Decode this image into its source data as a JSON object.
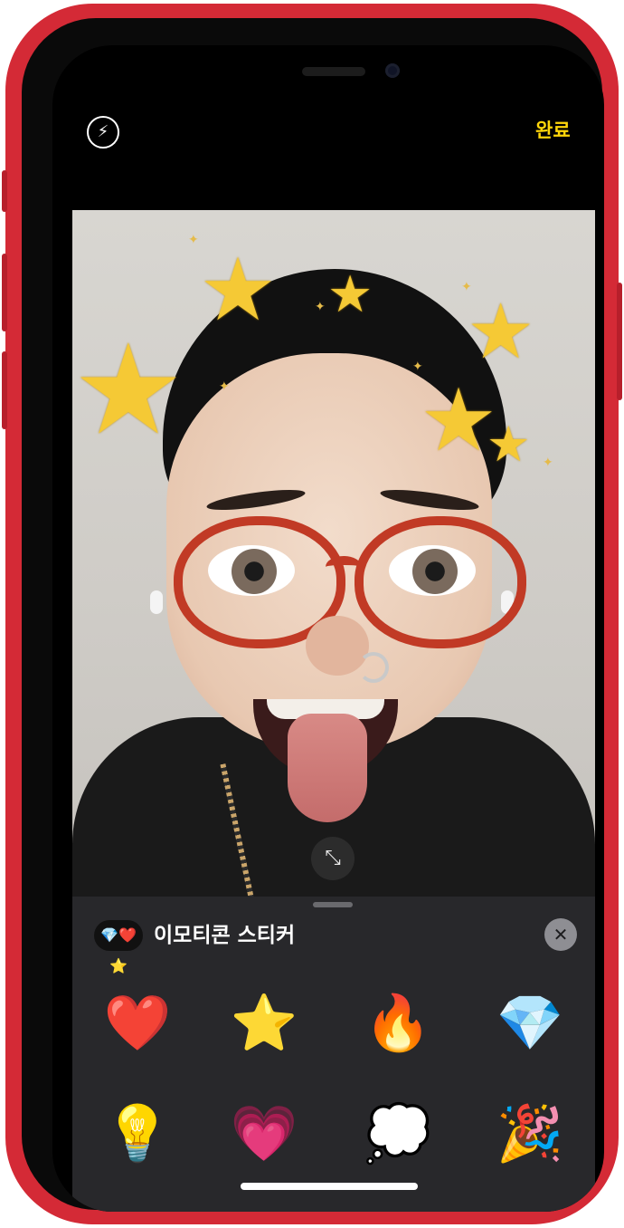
{
  "header": {
    "flash_icon": "⚡",
    "done_label": "완료"
  },
  "preview": {
    "expand_icon": "⤡"
  },
  "sticker_sheet": {
    "pack_icon": "💎❤️⭐",
    "pack_title": "이모티콘 스티커",
    "close_icon": "✕",
    "stickers": [
      {
        "name": "heart",
        "glyph": "❤️"
      },
      {
        "name": "star",
        "glyph": "⭐"
      },
      {
        "name": "fire",
        "glyph": "🔥"
      },
      {
        "name": "gem",
        "glyph": "💎"
      },
      {
        "name": "lightbulb",
        "glyph": "💡"
      },
      {
        "name": "pink-heart",
        "glyph": "💗"
      },
      {
        "name": "thought-cloud",
        "glyph": "💭"
      },
      {
        "name": "party-popper",
        "glyph": "🎉"
      }
    ]
  },
  "colors": {
    "accent": "#ffd60a",
    "device": "#d42a36",
    "sheet": "#28282b"
  }
}
